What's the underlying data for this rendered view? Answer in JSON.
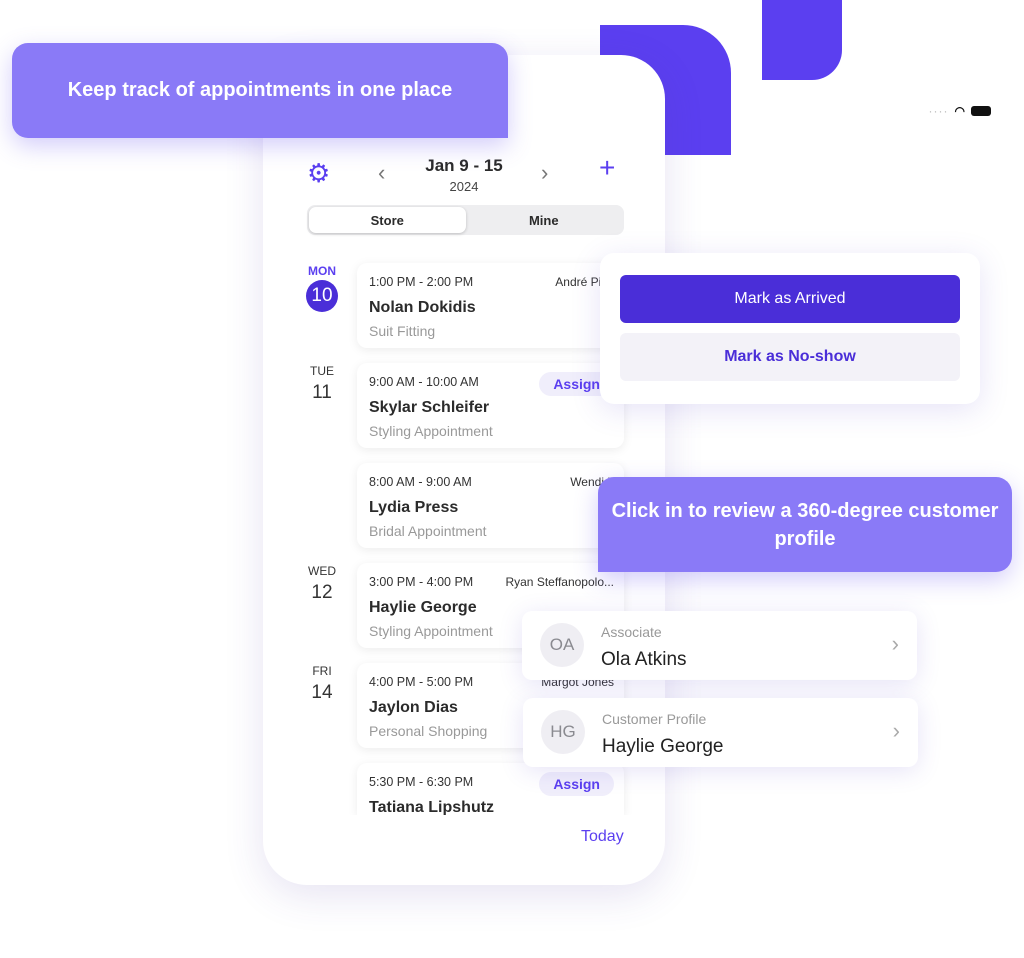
{
  "banners": {
    "top": "Keep track of appointments in one place",
    "profile": "Click in to review a 360-degree customer profile"
  },
  "header": {
    "week": "Jan 9 - 15",
    "year": "2024",
    "prev": "‹",
    "next": "›"
  },
  "segments": {
    "store": "Store",
    "mine": "Mine"
  },
  "days": [
    {
      "name": "MON",
      "num": "10"
    },
    {
      "name": "TUE",
      "num": "11"
    },
    {
      "name": "WED",
      "num": "12"
    },
    {
      "name": "FRI",
      "num": "14"
    }
  ],
  "appointments": [
    {
      "time": "1:00 PM - 2:00 PM",
      "associate": "André Pica",
      "name": "Nolan Dokidis",
      "type": "Suit Fitting"
    },
    {
      "time": "9:00 AM - 10:00 AM",
      "assign": "Assign",
      "name": "Skylar Schleifer",
      "type": "Styling Appointment"
    },
    {
      "time": "8:00 AM - 9:00 AM",
      "associate": "Wendi L",
      "name": "Lydia Press",
      "type": "Bridal Appointment"
    },
    {
      "time": "3:00 PM - 4:00 PM",
      "associate": "Ryan Steffanopolo...",
      "name": "Haylie George",
      "type": "Styling Appointment"
    },
    {
      "time": "4:00 PM - 5:00 PM",
      "associate": "Margot Jones",
      "name": "Jaylon Dias",
      "type": "Personal Shopping"
    },
    {
      "time": "5:30 PM - 6:30 PM",
      "assign": "Assign",
      "name": "Tatiana Lipshutz",
      "type": ""
    }
  ],
  "today": "Today",
  "actions": {
    "arrived": "Mark as Arrived",
    "noshow": "Mark as No-show"
  },
  "profiles": [
    {
      "initials": "OA",
      "label": "Associate",
      "value": "Ola Atkins"
    },
    {
      "initials": "HG",
      "label": "Customer Profile",
      "value": "Haylie George"
    }
  ],
  "colors": {
    "accent": "#5b3ff0",
    "button": "#4a2ed8",
    "banner": "#8a7af7"
  }
}
